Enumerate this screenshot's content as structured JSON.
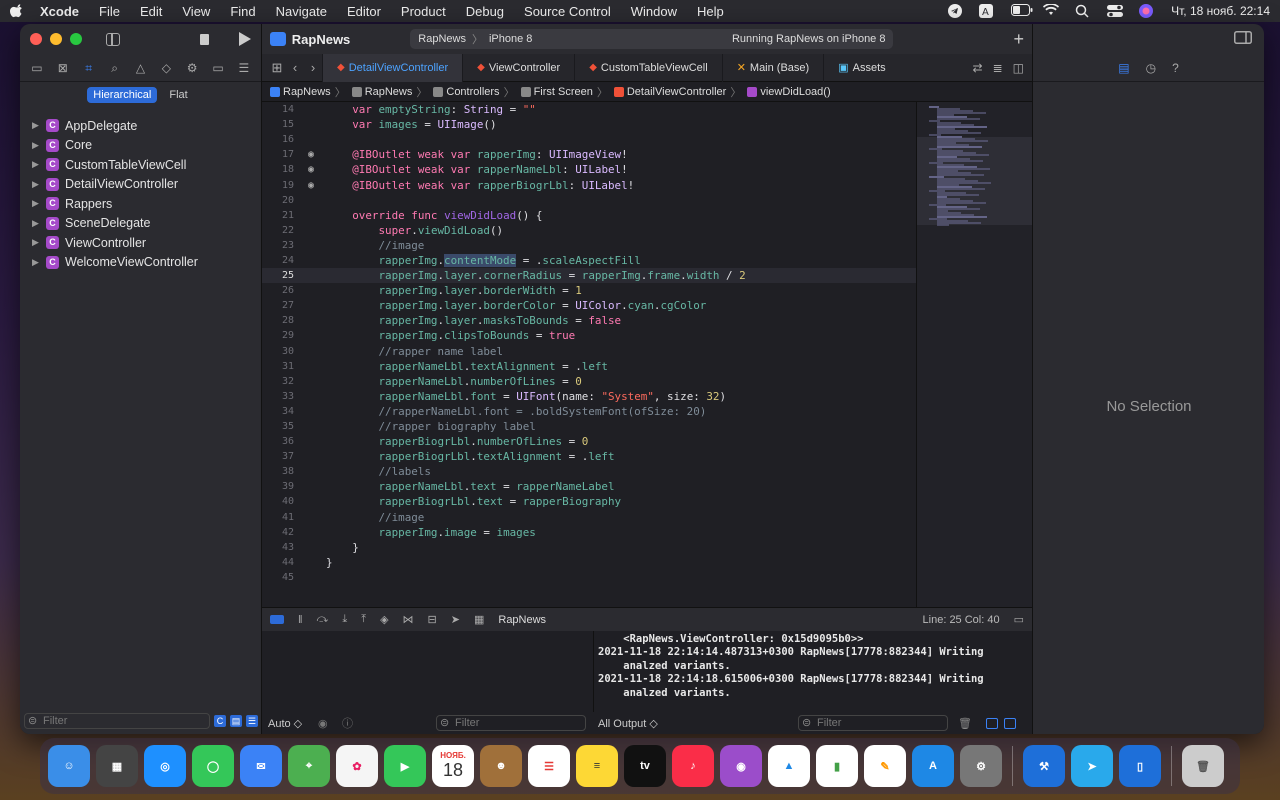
{
  "menubar": {
    "app": "Xcode",
    "items": [
      "File",
      "Edit",
      "View",
      "Find",
      "Navigate",
      "Editor",
      "Product",
      "Debug",
      "Source Control",
      "Window",
      "Help"
    ],
    "datetime": "Чт, 18 нояб.  22:14"
  },
  "navigator": {
    "scope": [
      "Hierarchical",
      "Flat"
    ],
    "items": [
      "AppDelegate",
      "Core",
      "CustomTableViewCell",
      "DetailViewController",
      "Rappers",
      "SceneDelegate",
      "ViewController",
      "WelcomeViewController"
    ],
    "filter_placeholder": "Filter"
  },
  "titlebar": {
    "project": "RapNews",
    "scheme": "RapNews",
    "device": "iPhone 8",
    "status": "Running RapNews on iPhone 8"
  },
  "tabs": [
    {
      "label": "DetailViewController",
      "kind": "swift",
      "active": true
    },
    {
      "label": "ViewController",
      "kind": "swift",
      "active": false
    },
    {
      "label": "CustomTableViewCell",
      "kind": "swift",
      "active": false
    },
    {
      "label": "Main (Base)",
      "kind": "ib",
      "active": false
    },
    {
      "label": "Assets",
      "kind": "asset",
      "active": false
    }
  ],
  "jumpbar": [
    "RapNews",
    "RapNews",
    "Controllers",
    "First Screen",
    "DetailViewController",
    "viewDidLoad()"
  ],
  "code": {
    "current_line": 25,
    "lines": [
      {
        "n": "14",
        "t": "    var emptyString: String = \"\""
      },
      {
        "n": "15",
        "t": "    var images = UIImage()"
      },
      {
        "n": "16",
        "t": ""
      },
      {
        "n": "17",
        "t": "    @IBOutlet weak var rapperImg: UIImageView!",
        "outlet": true
      },
      {
        "n": "18",
        "t": "    @IBOutlet weak var rapperNameLbl: UILabel!",
        "outlet": true
      },
      {
        "n": "19",
        "t": "    @IBOutlet weak var rapperBiogrLbl: UILabel!",
        "outlet": true
      },
      {
        "n": "20",
        "t": ""
      },
      {
        "n": "21",
        "t": "    override func viewDidLoad() {"
      },
      {
        "n": "22",
        "t": "        super.viewDidLoad()"
      },
      {
        "n": "23",
        "t": "        //image"
      },
      {
        "n": "24",
        "t": "        rapperImg.contentMode = .scaleAspectFill"
      },
      {
        "n": "25",
        "t": "        rapperImg.layer.cornerRadius = rapperImg.frame.width / 2"
      },
      {
        "n": "26",
        "t": "        rapperImg.layer.borderWidth = 1"
      },
      {
        "n": "27",
        "t": "        rapperImg.layer.borderColor = UIColor.cyan.cgColor"
      },
      {
        "n": "28",
        "t": "        rapperImg.layer.masksToBounds = false"
      },
      {
        "n": "29",
        "t": "        rapperImg.clipsToBounds = true"
      },
      {
        "n": "30",
        "t": "        //rapper name label"
      },
      {
        "n": "31",
        "t": "        rapperNameLbl.textAlignment = .left"
      },
      {
        "n": "32",
        "t": "        rapperNameLbl.numberOfLines = 0"
      },
      {
        "n": "33",
        "t": "        rapperNameLbl.font = UIFont(name: \"System\", size: 32)"
      },
      {
        "n": "34",
        "t": "        //rapperNameLbl.font = .boldSystemFont(ofSize: 20)"
      },
      {
        "n": "35",
        "t": "        //rapper biography label"
      },
      {
        "n": "36",
        "t": "        rapperBiogrLbl.numberOfLines = 0"
      },
      {
        "n": "37",
        "t": "        rapperBiogrLbl.textAlignment = .left"
      },
      {
        "n": "38",
        "t": "        //labels"
      },
      {
        "n": "39",
        "t": "        rapperNameLbl.text = rapperNameLabel"
      },
      {
        "n": "40",
        "t": "        rapperBiogrLbl.text = rapperBiography"
      },
      {
        "n": "41",
        "t": "        //image"
      },
      {
        "n": "42",
        "t": "        rapperImg.image = images"
      },
      {
        "n": "43",
        "t": "    }"
      },
      {
        "n": "44",
        "t": "}"
      },
      {
        "n": "45",
        "t": ""
      }
    ]
  },
  "debug": {
    "project": "RapNews",
    "linecol": "Line: 25  Col: 40"
  },
  "console": [
    "    <RapNews.ViewController: 0x15d9095b0>>",
    "2021-11-18 22:14:14.487313+0300 RapNews[17778:882344] Writing",
    "    analzed variants.",
    "2021-11-18 22:14:18.615006+0300 RapNews[17778:882344] Writing",
    "    analzed variants."
  ],
  "bottom": {
    "auto": "Auto ◇",
    "filter_placeholder": "Filter",
    "output": "All Output ◇",
    "console_filter_placeholder": "Filter"
  },
  "inspector": {
    "empty": "No Selection"
  },
  "dock": {
    "calendar_month": "НОЯБ.",
    "calendar_day": "18",
    "tv_label": "tv"
  }
}
